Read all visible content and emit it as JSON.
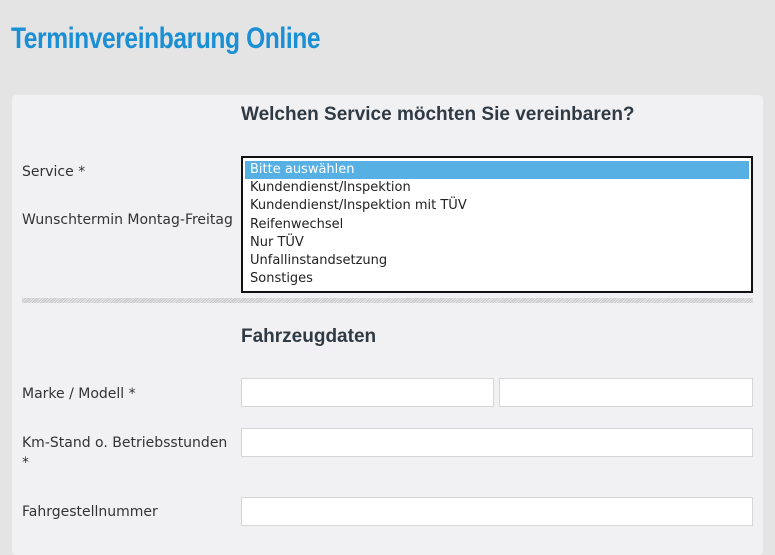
{
  "page": {
    "title": "Terminvereinbarung Online"
  },
  "service_section": {
    "heading": "Welchen Service möchten Sie vereinbaren?",
    "service_label": "Service *",
    "date_label": "Wunschtermin Montag-Freitag",
    "service_options": [
      "Bitte auswählen",
      "Kundendienst/Inspektion",
      "Kundendienst/Inspektion mit TÜV",
      "Reifenwechsel",
      "Nur TÜV",
      "Unfallinstandsetzung",
      "Sonstiges"
    ],
    "selected_option": "Bitte auswählen"
  },
  "vehicle_section": {
    "heading": "Fahrzeugdaten",
    "make_model_label": "Marke / Modell *",
    "make_value": "",
    "model_value": "",
    "mileage_label_line1": "Km-Stand o. Betriebsstunden",
    "mileage_label_line2": "*",
    "mileage_value": "",
    "vin_label": "Fahrgestellnummer",
    "vin_value": ""
  },
  "colors": {
    "title": "#1b8fd3",
    "selected_option_bg": "#56b0e3",
    "page_bg": "#e4e4e5",
    "card_bg": "#f1f1f3"
  }
}
